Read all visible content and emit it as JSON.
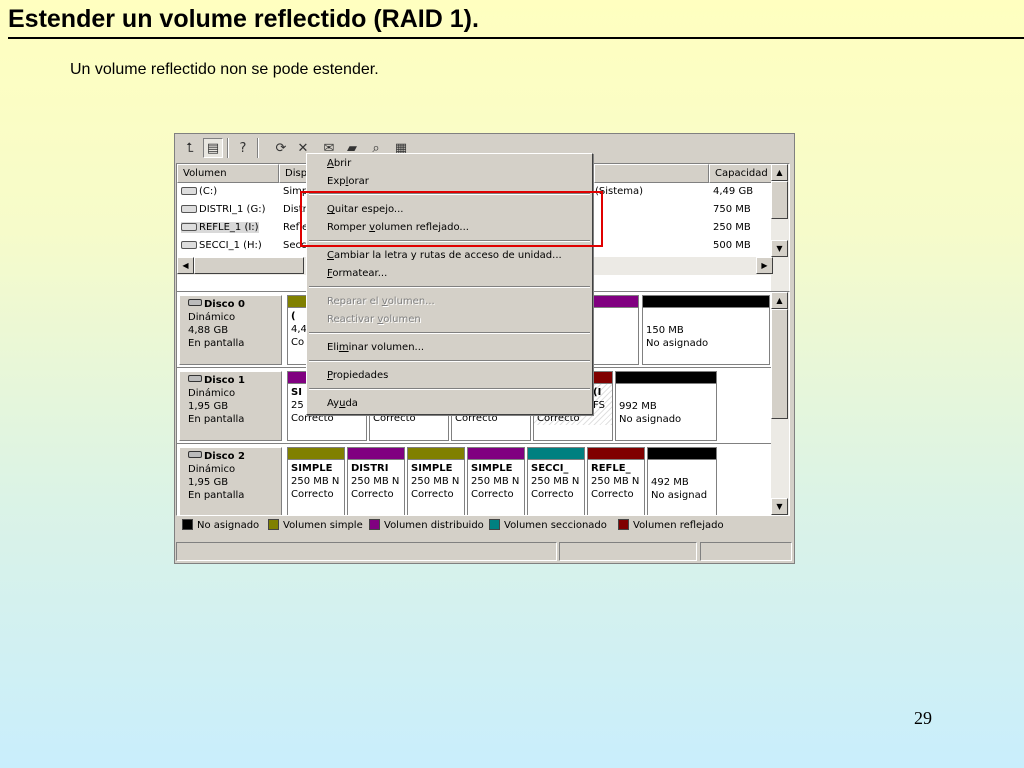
{
  "slide": {
    "title": "Estender un volume reflectido (RAID 1).",
    "subtitle": "Un volume reflectido non se pode estender.",
    "page_number": "29"
  },
  "toolbar": {
    "icons": [
      "up-folder-icon",
      "view-icon",
      "help-icon",
      "properties-icon",
      "delete-icon",
      "mail-icon",
      "open-folder-icon",
      "search-icon",
      "disk-manager-icon"
    ]
  },
  "volume_list": {
    "columns": [
      "Volumen",
      "Dispo",
      "Capacidad"
    ],
    "rows": [
      {
        "name": "(C:)",
        "type": "Simp",
        "status": "(Sistema)",
        "capacity": "4,49 GB"
      },
      {
        "name": "DISTRI_1 (G:)",
        "type": "Distri",
        "status": "",
        "capacity": "750 MB"
      },
      {
        "name": "REFLE_1 (I:)",
        "type": "Refle",
        "status": "",
        "capacity": "250 MB"
      },
      {
        "name": "SECCI_1 (H:)",
        "type": "Secc",
        "status": "",
        "capacity": "500 MB"
      }
    ]
  },
  "disks": [
    {
      "name": "Disco 0",
      "kind": "Dinámico",
      "size": "4,88 GB",
      "state": "En pantalla",
      "partitions": [
        {
          "bar_color": "#808000",
          "name": "(",
          "size": "4,4",
          "status": "Co"
        },
        {
          "bar_color": "#800080",
          "name": "",
          "size": "",
          "status": ""
        },
        {
          "bar_color": "#000000",
          "name": "",
          "size": "150 MB",
          "status": "No asignado"
        }
      ]
    },
    {
      "name": "Disco 1",
      "kind": "Dinámico",
      "size": "1,95 GB",
      "state": "En pantalla",
      "partitions": [
        {
          "bar_color": "#800080",
          "name": "SI",
          "size": "25",
          "status": "Correcto"
        },
        {
          "bar_color": "#808000",
          "name": "",
          "size": "",
          "status": "Correcto"
        },
        {
          "bar_color": "#808000",
          "name": "",
          "size": "",
          "status": "Correcto"
        },
        {
          "bar_color": "#800000",
          "name": "(I",
          "size": "FS",
          "status": "Correcto"
        },
        {
          "bar_color": "#000000",
          "name": "",
          "size": "992 MB",
          "status": "No asignado"
        }
      ]
    },
    {
      "name": "Disco 2",
      "kind": "Dinámico",
      "size": "1,95 GB",
      "state": "En pantalla",
      "partitions": [
        {
          "bar_color": "#808000",
          "name": "SIMPLE",
          "size": "250 MB N",
          "status": "Correcto"
        },
        {
          "bar_color": "#800080",
          "name": "DISTRI",
          "size": "250 MB N",
          "status": "Correcto"
        },
        {
          "bar_color": "#808000",
          "name": "SIMPLE",
          "size": "250 MB N",
          "status": "Correcto"
        },
        {
          "bar_color": "#800080",
          "name": "SIMPLE",
          "size": "250 MB N",
          "status": "Correcto"
        },
        {
          "bar_color": "#008080",
          "name": "SECCI_",
          "size": "250 MB N",
          "status": "Correcto"
        },
        {
          "bar_color": "#800000",
          "name": "REFLE_",
          "size": "250 MB N",
          "status": "Correcto"
        },
        {
          "bar_color": "#000000",
          "name": "",
          "size": "492 MB",
          "status": "No asignad"
        }
      ]
    }
  ],
  "legend": [
    {
      "color": "#000000",
      "label": "No asignado"
    },
    {
      "color": "#808000",
      "label": "Volumen simple"
    },
    {
      "color": "#800080",
      "label": "Volumen distribuido"
    },
    {
      "color": "#008080",
      "label": "Volumen seccionado"
    },
    {
      "color": "#800000",
      "label": "Volumen reflejado"
    }
  ],
  "context_menu": {
    "open": "Abrir",
    "explore": "Explorar",
    "remove_mirror": "Quitar espejo...",
    "break_mirror": "Romper volumen reflejado...",
    "change_letter": "Cambiar la letra y rutas de acceso de unidad...",
    "format": "Formatear...",
    "repair": "Reparar el volumen...",
    "reactivate": "Reactivar volumen",
    "delete": "Eliminar volumen...",
    "properties": "Propiedades",
    "help": "Ayuda"
  },
  "colors": {
    "highlight": "#e00000",
    "unassigned": "#000000",
    "simple": "#808000",
    "spanned": "#800080",
    "striped": "#008080",
    "mirrored": "#800000"
  }
}
